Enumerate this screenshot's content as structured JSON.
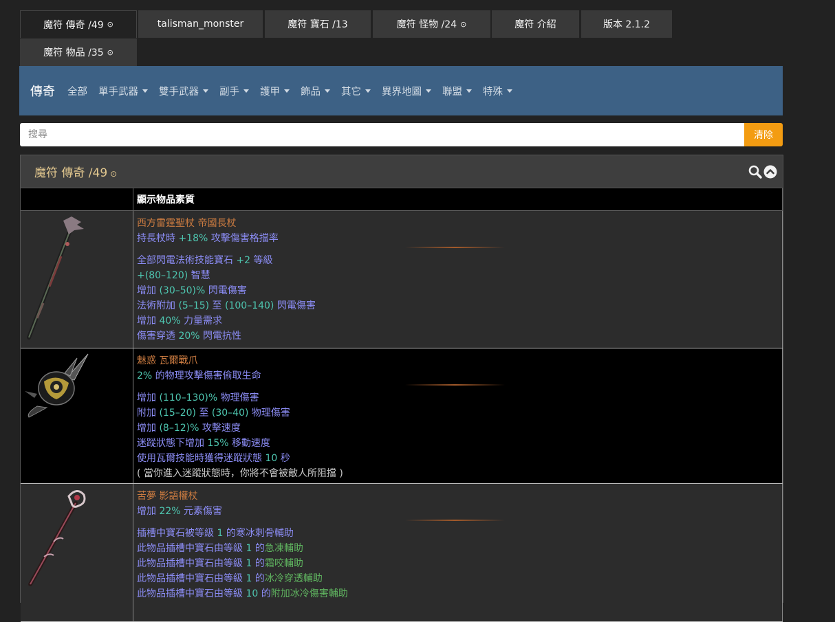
{
  "tabs": [
    {
      "label": "魔符 傳奇 /49",
      "icon": "circle-dot-icon",
      "active": true
    },
    {
      "label": "talisman_monster"
    },
    {
      "label": "魔符 寶石 /13"
    },
    {
      "label": "魔符 怪物 /24",
      "icon": "circle-dot-icon"
    },
    {
      "label": "魔符 介紹"
    },
    {
      "label": "版本 2.1.2"
    },
    {
      "label": "魔符 物品 /35",
      "icon": "circle-dot-icon"
    }
  ],
  "navbar": {
    "brand": "傳奇",
    "items": [
      "全部",
      "單手武器",
      "雙手武器",
      "副手",
      "護甲",
      "飾品",
      "其它",
      "異界地圖",
      "聯盟",
      "特殊"
    ]
  },
  "search": {
    "placeholder": "搜尋",
    "value": "",
    "clear_label": "清除"
  },
  "panel": {
    "title": "魔符 傳奇 /49",
    "title_icon": "circle-dot-icon",
    "column_header": "顯示物品素質"
  },
  "colors": {
    "accent": "#f39c12",
    "navbar": "#3d6185",
    "title": "#e3c88f",
    "item_name": "#c97a40",
    "mod_text": "#8b8cf4",
    "number": "#4ec6b0",
    "gem": "#5fb35f"
  },
  "items": [
    {
      "name": "西方雷霆聖杖 帝國長杖",
      "implicit": [
        {
          "a": "持長杖時 ",
          "n": "+18%",
          "b": " 攻擊傷害格擋率"
        }
      ],
      "mods": [
        {
          "a": "全部閃電法術技能寶石 ",
          "n": "+2",
          "b": " 等級"
        },
        {
          "a": "",
          "n": "+(80–120)",
          "b": " 智慧"
        },
        {
          "a": "增加 ",
          "n": "(30–50)%",
          "b": " 閃電傷害"
        },
        {
          "a": "法術附加 ",
          "n": "(5–15)",
          "b": " 至 ",
          "n2": "(100–140)",
          "c": " 閃電傷害"
        },
        {
          "a": "增加 ",
          "n": "40%",
          "b": " 力量需求"
        },
        {
          "a": "傷害穿透 ",
          "n": "20%",
          "b": " 閃電抗性"
        }
      ]
    },
    {
      "name": "魅惑 瓦爾戰爪",
      "implicit": [
        {
          "a": "",
          "n": "2%",
          "b": " 的物理攻擊傷害偷取生命"
        }
      ],
      "mods": [
        {
          "a": "增加 ",
          "n": "(110–130)%",
          "b": " 物理傷害"
        },
        {
          "a": "附加 ",
          "n": "(15–20)",
          "b": " 至 ",
          "n2": "(30–40)",
          "c": " 物理傷害"
        },
        {
          "a": "增加 ",
          "n": "(8–12)%",
          "b": " 攻擊速度"
        },
        {
          "a": "迷蹤狀態下增加 ",
          "n": "15%",
          "b": " 移動速度"
        },
        {
          "a": "使用瓦爾技能時獲得迷蹤狀態 ",
          "n": "10",
          "b": " 秒"
        }
      ],
      "flavor": "( 當你進入迷蹤狀態時，你將不會被敵人所阻擋 )"
    },
    {
      "name": "苦夢 影語權杖",
      "implicit": [
        {
          "a": "增加 ",
          "n": "22%",
          "b": " 元素傷害"
        }
      ],
      "mods": [
        {
          "a": "插槽中寶石被等級 ",
          "n": "1",
          "b": " 的寒冰刺骨輔助"
        },
        {
          "a": "此物品插槽中寶石由等級 ",
          "n": "1",
          "b": " 的",
          "g": "急凍輔助"
        },
        {
          "a": "此物品插槽中寶石由等級 ",
          "n": "1",
          "b": " 的",
          "g": "霜咬輔助"
        },
        {
          "a": "此物品插槽中寶石由等級 ",
          "n": "1",
          "b": " 的",
          "g": "冰冷穿透輔助"
        },
        {
          "a": "此物品插槽中寶石由等級 ",
          "n": "10",
          "b": " 的",
          "g": "附加冰冷傷害輔助"
        }
      ]
    }
  ]
}
